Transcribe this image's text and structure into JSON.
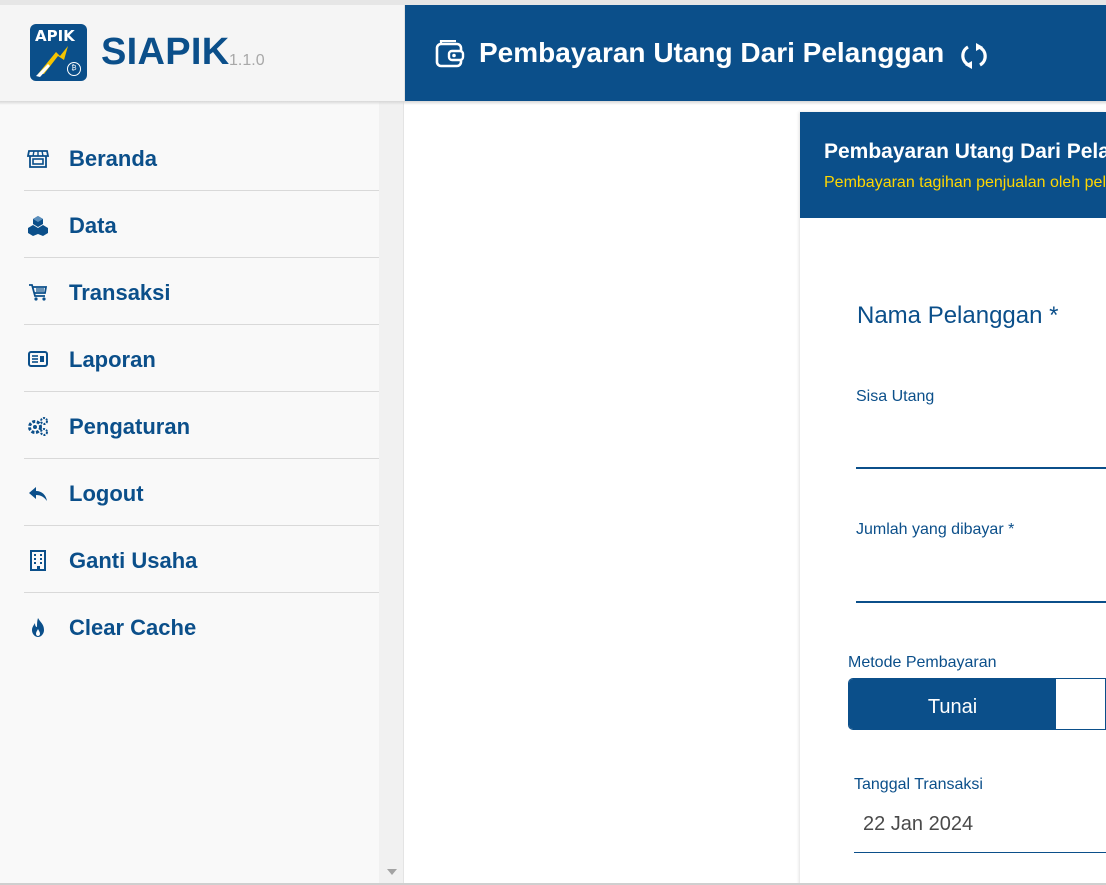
{
  "brand": {
    "name": "SIAPIK",
    "version": "1.1.0",
    "logo_text": "APIK"
  },
  "header": {
    "title": "Pembayaran Utang Dari Pelanggan",
    "icon": "wallet-icon",
    "refresh_icon": "refresh-icon"
  },
  "sidebar": {
    "items": [
      {
        "label": "Beranda",
        "icon": "store-icon"
      },
      {
        "label": "Data",
        "icon": "boxes-icon"
      },
      {
        "label": "Transaksi",
        "icon": "cart-icon"
      },
      {
        "label": "Laporan",
        "icon": "newspaper-icon"
      },
      {
        "label": "Pengaturan",
        "icon": "gears-icon"
      },
      {
        "label": "Logout",
        "icon": "reply-icon"
      },
      {
        "label": "Ganti Usaha",
        "icon": "building-icon"
      },
      {
        "label": "Clear Cache",
        "icon": "fire-icon"
      }
    ]
  },
  "form": {
    "title": "Pembayaran Utang Dari Pelanggan",
    "subtitle": "Pembayaran tagihan penjualan oleh pelanggan",
    "customer_label": "Nama Pelanggan *",
    "remaining_label": "Sisa Utang",
    "remaining_value": "",
    "amount_label": "Jumlah yang dibayar *",
    "amount_value": "",
    "method_label": "Metode Pembayaran",
    "method_selected": "Tunai",
    "date_label": "Tanggal Transaksi",
    "date_value": "22 Jan 2024"
  },
  "colors": {
    "primary": "#0b4f8a",
    "accent_yellow": "#ffd600",
    "sidebar_bg": "#f9f9f9"
  }
}
